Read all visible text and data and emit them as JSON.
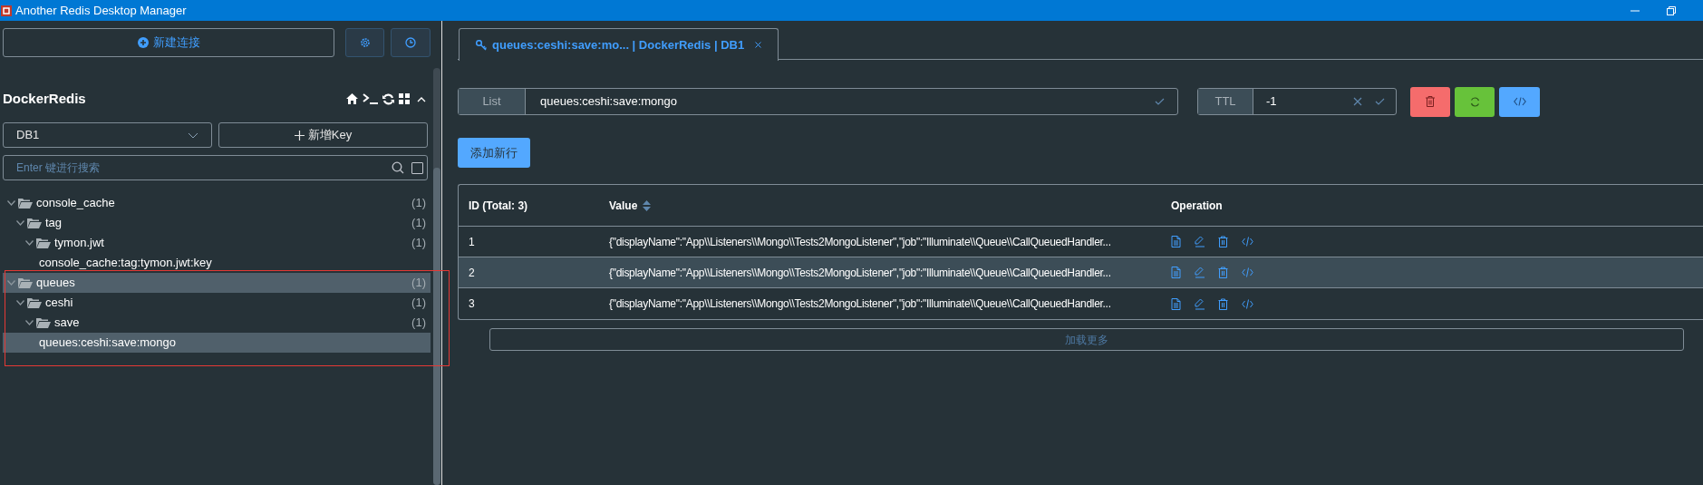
{
  "window": {
    "title": "Another Redis Desktop Manager"
  },
  "sidebar": {
    "new_connection_button": "新建连接",
    "connection": {
      "name": "DockerRedis",
      "expanded": true
    },
    "db_select": {
      "value": "DB1"
    },
    "new_key_button": "新增Key",
    "search": {
      "placeholder": "Enter 键进行搜索",
      "exact": false
    },
    "tree": [
      {
        "label": "console_cache",
        "count": "(1)",
        "expanded": true,
        "selected": false,
        "children": [
          {
            "label": "tag",
            "count": "(1)",
            "expanded": true,
            "selected": false,
            "children": [
              {
                "label": "tymon.jwt",
                "count": "(1)",
                "expanded": true,
                "selected": false,
                "children": [
                  {
                    "label": "console_cache:tag:tymon.jwt:key",
                    "selected": false
                  }
                ]
              }
            ]
          }
        ]
      },
      {
        "label": "queues",
        "count": "(1)",
        "expanded": true,
        "selected": true,
        "children": [
          {
            "label": "ceshi",
            "count": "(1)",
            "expanded": true,
            "selected": false,
            "children": [
              {
                "label": "save",
                "count": "(1)",
                "expanded": true,
                "selected": false,
                "children": [
                  {
                    "label": "queues:ceshi:save:mongo",
                    "selected": true
                  }
                ]
              }
            ]
          }
        ]
      }
    ]
  },
  "tabs": [
    {
      "label": "queues:ceshi:save:mo... | DockerRedis | DB1",
      "selected": true
    }
  ],
  "key": {
    "type": "List",
    "name": "queues:ceshi:save:mongo",
    "ttl_label": "TTL",
    "ttl": "-1"
  },
  "add_row_button": "添加新行",
  "table": {
    "columns": [
      "ID (Total: 3)",
      "Value",
      "Operation"
    ],
    "rows": [
      {
        "id": "1",
        "value": "{\"displayName\":\"App\\\\Listeners\\\\Mongo\\\\Tests2MongoListener\",\"job\":\"Illuminate\\\\Queue\\\\CallQueuedHandler...",
        "selected": false
      },
      {
        "id": "2",
        "value": "{\"displayName\":\"App\\\\Listeners\\\\Mongo\\\\Tests2MongoListener\",\"job\":\"Illuminate\\\\Queue\\\\CallQueuedHandler...",
        "selected": true
      },
      {
        "id": "3",
        "value": "{\"displayName\":\"App\\\\Listeners\\\\Mongo\\\\Tests2MongoListener\",\"job\":\"Illuminate\\\\Queue\\\\CallQueuedHandler...",
        "selected": false
      }
    ]
  },
  "load_more_button": "加载更多"
}
